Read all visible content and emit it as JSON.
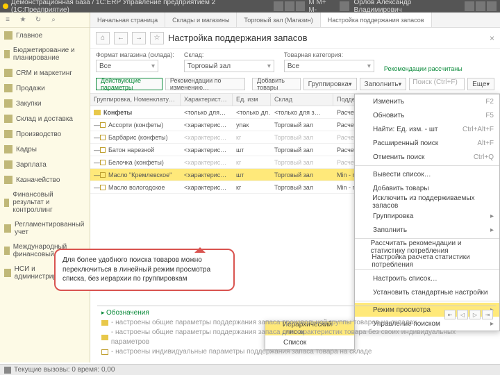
{
  "titlebar": {
    "title": "Демонстрационная база / 1С:ERP Управление предприятием 2 (1С:Предприятие)",
    "user": "Орлов Александр Владимирович"
  },
  "sidebar": {
    "items": [
      {
        "label": "Главное"
      },
      {
        "label": "Бюджетирование и планирование"
      },
      {
        "label": "CRM и маркетинг"
      },
      {
        "label": "Продажи"
      },
      {
        "label": "Закупки"
      },
      {
        "label": "Склад и доставка"
      },
      {
        "label": "Производство"
      },
      {
        "label": "Кадры"
      },
      {
        "label": "Зарплата"
      },
      {
        "label": "Казначейство"
      },
      {
        "label": "Финансовый результат и контроллинг"
      },
      {
        "label": "Регламентированный учет"
      },
      {
        "label": "Международный финансовый учет"
      },
      {
        "label": "НСИ и администрирование"
      }
    ]
  },
  "tabs": {
    "items": [
      {
        "label": "Начальная страница"
      },
      {
        "label": "Склады и магазины"
      },
      {
        "label": "Торговый зал (Магазин)"
      },
      {
        "label": "Настройка поддержания запасов"
      }
    ],
    "active": 3
  },
  "page": {
    "title": "Настройка поддержания запасов"
  },
  "filters": {
    "f1": {
      "label": "Формат магазина (склада):",
      "value": "Все"
    },
    "f2": {
      "label": "Склад:",
      "value": "Торговый зал"
    },
    "f3": {
      "label": "Товарная категория:",
      "value": "Все"
    },
    "link": "Рекомендации рассчитаны"
  },
  "toolbar": {
    "b1": "Действующие параметры",
    "b2": "Рекомендации по изменению…",
    "b3": "Добавить товары",
    "b4": "Группировка",
    "b5": "Заполнить",
    "b6": "Еще",
    "search": "Поиск (Ctrl+F)"
  },
  "grid": {
    "headers": [
      "Группировка, Номенклату…",
      "Характерист…",
      "Ед. изм",
      "Склад",
      "Поддержание запаса"
    ],
    "rows": [
      {
        "group": true,
        "c1": "Конфеты",
        "c2": "<только для…",
        "c3": "<только дл…",
        "c4": "<только для з…",
        "c5": "Расчет по статистике"
      },
      {
        "c1": "Ассорти (конфеты)",
        "c2": "<характерис…",
        "c3": "упак",
        "c4": "Торговый зал",
        "c5": "Расчет по статистике"
      },
      {
        "c1": "Барбарис (конфеты)",
        "c2": "<характерис…",
        "c3": "кг",
        "c4": "Торговый зал",
        "c5": "Расчет по статистике",
        "dim": true
      },
      {
        "c1": "Батон нарезной",
        "c2": "<характерис…",
        "c3": "шт",
        "c4": "Торговый зал",
        "c5": "Расчет по норме"
      },
      {
        "c1": "Белочка (конфеты)",
        "c2": "<характерис…",
        "c3": "кг",
        "c4": "Торговый зал",
        "c5": "Расчет по статистике",
        "dim": true
      },
      {
        "sel": true,
        "c1": "Масло \"Кремлевское\"",
        "c2": "<характерис…",
        "c3": "шт",
        "c4": "Торговый зал",
        "c5": "Min - max"
      },
      {
        "c1": "Масло вологодское",
        "c2": "<характерис…",
        "c3": "кг",
        "c4": "Торговый зал",
        "c5": "Min - max"
      }
    ]
  },
  "context": {
    "items": [
      {
        "label": "Изменить",
        "sc": "F2"
      },
      {
        "label": "Обновить",
        "sc": "F5"
      },
      {
        "label": "Найти: Ед. изм. - шт",
        "sc": "Ctrl+Alt+F"
      },
      {
        "label": "Расширенный поиск",
        "sc": "Alt+F"
      },
      {
        "label": "Отменить поиск",
        "sc": "Ctrl+Q"
      },
      {
        "sep": true
      },
      {
        "label": "Вывести список…"
      },
      {
        "label": "Добавить товары"
      },
      {
        "label": "Исключить из поддерживаемых запасов"
      },
      {
        "label": "Группировка",
        "sub": true
      },
      {
        "label": "Заполнить",
        "sub": true
      },
      {
        "sep": true
      },
      {
        "label": "Рассчитать рекомендации и статистику потребления"
      },
      {
        "label": "Настройка расчета статистики потребления"
      },
      {
        "sep": true
      },
      {
        "label": "Настроить список…"
      },
      {
        "label": "Установить стандартные настройки"
      },
      {
        "sep": true
      },
      {
        "label": "Режим просмотра",
        "sub": true,
        "hl": true
      },
      {
        "label": "Управление поиском",
        "sub": true
      }
    ]
  },
  "submenu": {
    "items": [
      {
        "label": "Иерархический список",
        "hl": true
      },
      {
        "label": "Список"
      }
    ]
  },
  "callout": {
    "text": "Для более удобного поиска товаров можно переключиться в линейный режим просмотра списка, без иерархии по группировкам"
  },
  "legend": {
    "title": "Обозначения",
    "l1": "- настроены общие параметры поддержания запаса произвольной группы товаров на складах",
    "l2": "- настроены общие параметры поддержания запаса для характеристик товара без своих индивидуальных параметров",
    "l3": "- настроены индивидуальные параметры поддержания запаса товара на складе"
  },
  "status": {
    "text": "Текущие вызовы: 0  время: 0,00"
  }
}
